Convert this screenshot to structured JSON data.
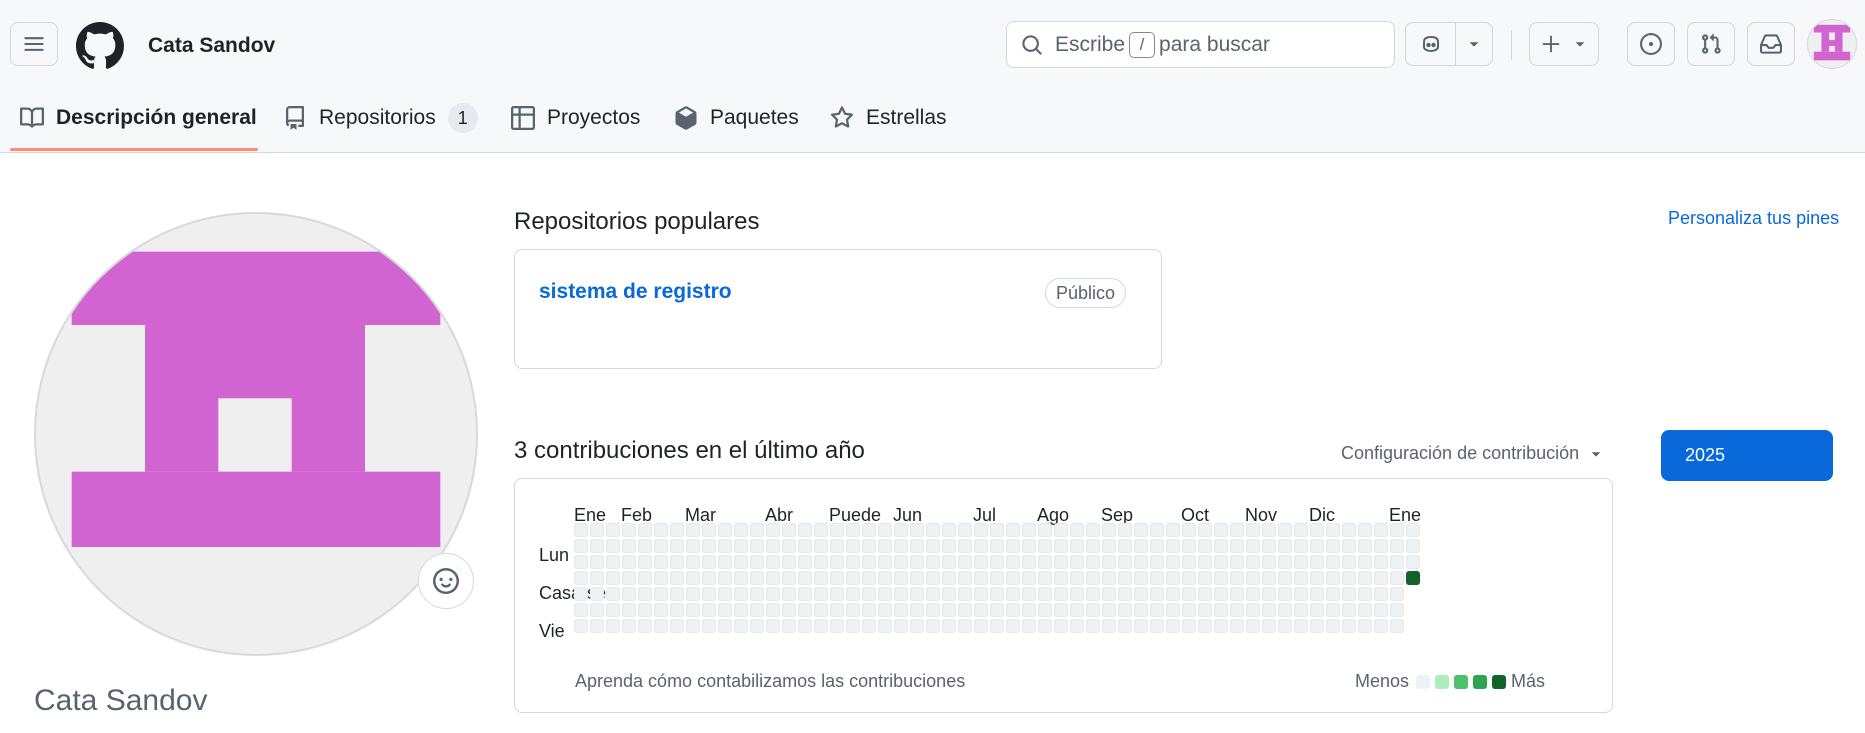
{
  "header": {
    "user_title": "Cata Sandov",
    "search": {
      "prefix": "Escribe",
      "key": "/",
      "suffix": "para buscar"
    }
  },
  "tabs": [
    {
      "label": "Descripción general",
      "icon": "book-icon",
      "selected": true
    },
    {
      "label": "Repositorios",
      "icon": "repo-icon",
      "count": "1"
    },
    {
      "label": "Proyectos",
      "icon": "table-icon"
    },
    {
      "label": "Paquetes",
      "icon": "package-icon"
    },
    {
      "label": "Estrellas",
      "icon": "star-icon"
    }
  ],
  "profile": {
    "full_name": "Cata Sandov",
    "avatar_color": "#d264d2"
  },
  "popular": {
    "title": "Repositorios populares",
    "customize_link": "Personaliza tus pines",
    "repos": [
      {
        "name": "sistema de registro",
        "visibility": "Público"
      }
    ]
  },
  "contributions": {
    "title": "3 contribuciones en el último año",
    "settings_label": "Configuración de contribución",
    "year": "2025",
    "months": [
      "Ene",
      "Feb",
      "Mar",
      "Abr",
      "Puede",
      "Jun",
      "Jul",
      "Ago",
      "Sep",
      "Oct",
      "Nov",
      "Dic",
      "Ene"
    ],
    "day_labels": [
      "Lun",
      "Casarse",
      "Vie"
    ],
    "learn_link": "Aprenda cómo contabilizamos las contribuciones",
    "legend_less": "Menos",
    "legend_more": "Más",
    "legend_colors": [
      "#eff2f5",
      "#aceebb",
      "#4ac26b",
      "#2da44e",
      "#116329"
    ],
    "active_cell": {
      "week": 52,
      "day": 3,
      "level": 4
    }
  }
}
